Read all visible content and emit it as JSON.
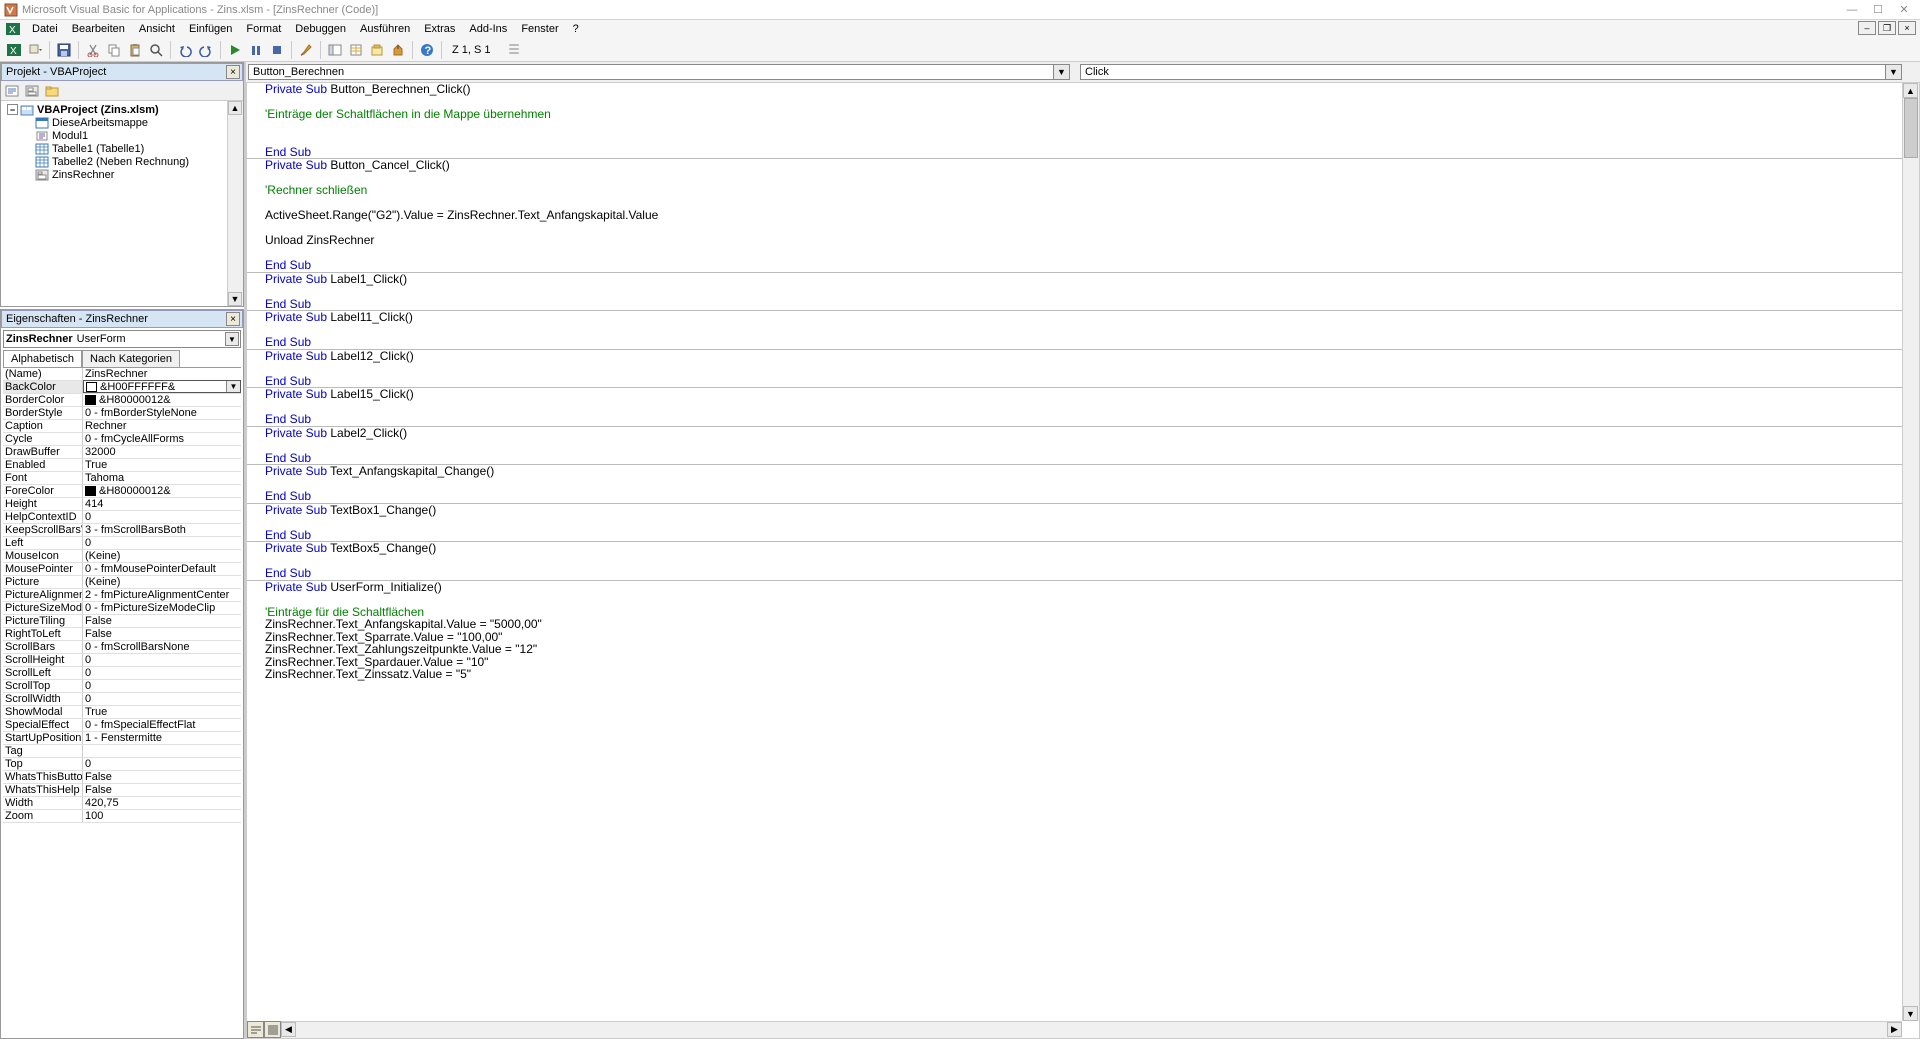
{
  "title": "Microsoft Visual Basic for Applications - Zins.xlsm - [ZinsRechner (Code)]",
  "menu": {
    "items": [
      "Datei",
      "Bearbeiten",
      "Ansicht",
      "Einfügen",
      "Format",
      "Debuggen",
      "Ausführen",
      "Extras",
      "Add-Ins",
      "Fenster",
      "?"
    ]
  },
  "toolbar": {
    "position": "Z 1, S 1"
  },
  "project_panel": {
    "title": "Projekt - VBAProject",
    "root": "VBAProject (Zins.xlsm)",
    "items": [
      "DieseArbeitsmappe",
      "Modul1",
      "Tabelle1 (Tabelle1)",
      "Tabelle2 (Neben Rechnung)",
      "ZinsRechner"
    ]
  },
  "props_panel": {
    "title": "Eigenschaften - ZinsRechner",
    "object_name": "ZinsRechner",
    "object_type": "UserForm",
    "tabs": [
      "Alphabetisch",
      "Nach Kategorien"
    ],
    "rows": [
      {
        "n": "(Name)",
        "v": "ZinsRechner"
      },
      {
        "n": "BackColor",
        "v": "&H00FFFFFF&",
        "sw": "#ffffff",
        "sel": true
      },
      {
        "n": "BorderColor",
        "v": "&H80000012&",
        "sw": "#000000"
      },
      {
        "n": "BorderStyle",
        "v": "0 - fmBorderStyleNone"
      },
      {
        "n": "Caption",
        "v": "Rechner"
      },
      {
        "n": "Cycle",
        "v": "0 - fmCycleAllForms"
      },
      {
        "n": "DrawBuffer",
        "v": "32000"
      },
      {
        "n": "Enabled",
        "v": "True"
      },
      {
        "n": "Font",
        "v": "Tahoma"
      },
      {
        "n": "ForeColor",
        "v": "&H80000012&",
        "sw": "#000000"
      },
      {
        "n": "Height",
        "v": "414"
      },
      {
        "n": "HelpContextID",
        "v": "0"
      },
      {
        "n": "KeepScrollBarsVisible",
        "v": "3 - fmScrollBarsBoth"
      },
      {
        "n": "Left",
        "v": "0"
      },
      {
        "n": "MouseIcon",
        "v": "(Keine)"
      },
      {
        "n": "MousePointer",
        "v": "0 - fmMousePointerDefault"
      },
      {
        "n": "Picture",
        "v": "(Keine)"
      },
      {
        "n": "PictureAlignment",
        "v": "2 - fmPictureAlignmentCenter"
      },
      {
        "n": "PictureSizeMode",
        "v": "0 - fmPictureSizeModeClip"
      },
      {
        "n": "PictureTiling",
        "v": "False"
      },
      {
        "n": "RightToLeft",
        "v": "False"
      },
      {
        "n": "ScrollBars",
        "v": "0 - fmScrollBarsNone"
      },
      {
        "n": "ScrollHeight",
        "v": "0"
      },
      {
        "n": "ScrollLeft",
        "v": "0"
      },
      {
        "n": "ScrollTop",
        "v": "0"
      },
      {
        "n": "ScrollWidth",
        "v": "0"
      },
      {
        "n": "ShowModal",
        "v": "True"
      },
      {
        "n": "SpecialEffect",
        "v": "0 - fmSpecialEffectFlat"
      },
      {
        "n": "StartUpPosition",
        "v": "1 - Fenstermitte"
      },
      {
        "n": "Tag",
        "v": ""
      },
      {
        "n": "Top",
        "v": "0"
      },
      {
        "n": "WhatsThisButton",
        "v": "False"
      },
      {
        "n": "WhatsThisHelp",
        "v": "False"
      },
      {
        "n": "Width",
        "v": "420,75"
      },
      {
        "n": "Zoom",
        "v": "100"
      }
    ]
  },
  "code": {
    "combo_object": "Button_Berechnen",
    "combo_proc": "Click",
    "lines": [
      {
        "t": "sub",
        "s": "Private Sub ",
        "r": "Button_Berechnen_Click()"
      },
      {
        "t": "blank"
      },
      {
        "t": "cm",
        "r": "'Einträge der Schaltflächen in die Mappe übernehmen"
      },
      {
        "t": "blank"
      },
      {
        "t": "blank"
      },
      {
        "t": "end"
      },
      {
        "t": "hr"
      },
      {
        "t": "sub",
        "s": "Private Sub ",
        "r": "Button_Cancel_Click()"
      },
      {
        "t": "blank"
      },
      {
        "t": "cm",
        "r": "'Rechner schließen"
      },
      {
        "t": "blank"
      },
      {
        "t": "plain",
        "r": "ActiveSheet.Range(\"G2\").Value = ZinsRechner.Text_Anfangskapital.Value"
      },
      {
        "t": "blank"
      },
      {
        "t": "plain",
        "r": "Unload ZinsRechner"
      },
      {
        "t": "blank"
      },
      {
        "t": "end"
      },
      {
        "t": "hr"
      },
      {
        "t": "sub",
        "s": "Private Sub ",
        "r": "Label1_Click()"
      },
      {
        "t": "blank"
      },
      {
        "t": "end"
      },
      {
        "t": "hr"
      },
      {
        "t": "sub",
        "s": "Private Sub ",
        "r": "Label11_Click()"
      },
      {
        "t": "blank"
      },
      {
        "t": "end"
      },
      {
        "t": "hr"
      },
      {
        "t": "sub",
        "s": "Private Sub ",
        "r": "Label12_Click()"
      },
      {
        "t": "blank"
      },
      {
        "t": "end"
      },
      {
        "t": "hr"
      },
      {
        "t": "sub",
        "s": "Private Sub ",
        "r": "Label15_Click()"
      },
      {
        "t": "blank"
      },
      {
        "t": "end"
      },
      {
        "t": "hr"
      },
      {
        "t": "sub",
        "s": "Private Sub ",
        "r": "Label2_Click()"
      },
      {
        "t": "blank"
      },
      {
        "t": "end"
      },
      {
        "t": "hr"
      },
      {
        "t": "sub",
        "s": "Private Sub ",
        "r": "Text_Anfangskapital_Change()"
      },
      {
        "t": "blank"
      },
      {
        "t": "end"
      },
      {
        "t": "hr"
      },
      {
        "t": "sub",
        "s": "Private Sub ",
        "r": "TextBox1_Change()"
      },
      {
        "t": "blank"
      },
      {
        "t": "end"
      },
      {
        "t": "hr"
      },
      {
        "t": "sub",
        "s": "Private Sub ",
        "r": "TextBox5_Change()"
      },
      {
        "t": "blank"
      },
      {
        "t": "end"
      },
      {
        "t": "hr"
      },
      {
        "t": "sub",
        "s": "Private Sub ",
        "r": "UserForm_Initialize()"
      },
      {
        "t": "blank"
      },
      {
        "t": "cm",
        "r": "'Einträge für die Schaltflächen"
      },
      {
        "t": "plain",
        "r": "ZinsRechner.Text_Anfangskapital.Value = \"5000,00\""
      },
      {
        "t": "plain",
        "r": "ZinsRechner.Text_Sparrate.Value = \"100,00\""
      },
      {
        "t": "plain",
        "r": "ZinsRechner.Text_Zahlungszeitpunkte.Value = \"12\""
      },
      {
        "t": "plain",
        "r": "ZinsRechner.Text_Spardauer.Value = \"10\""
      },
      {
        "t": "plain",
        "r": "ZinsRechner.Text_Zinssatz.Value = \"5\""
      }
    ]
  }
}
